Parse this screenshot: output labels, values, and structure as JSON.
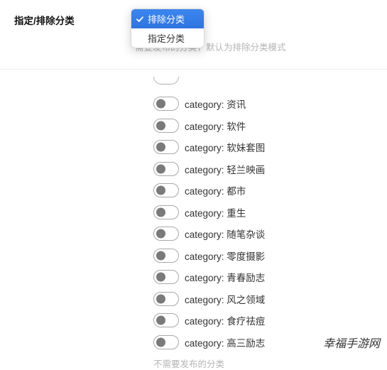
{
  "section": {
    "label": "指定/排除分类",
    "helper": "需要发布的分类，默认为排除分类模式"
  },
  "dropdown": {
    "options": [
      {
        "label": "排除分类",
        "selected": true
      },
      {
        "label": "指定分类",
        "selected": false
      }
    ]
  },
  "category_prefix": "category:",
  "categories": [
    "资讯",
    "软件",
    "软妹套图",
    "轻兰映画",
    "都市",
    "重生",
    "随笔杂谈",
    "零度摄影",
    "青春励志",
    "风之领域",
    "食疗祛痘",
    "高三励志"
  ],
  "bottom_help": "不需要发布的分类",
  "watermark": "幸福手游网"
}
